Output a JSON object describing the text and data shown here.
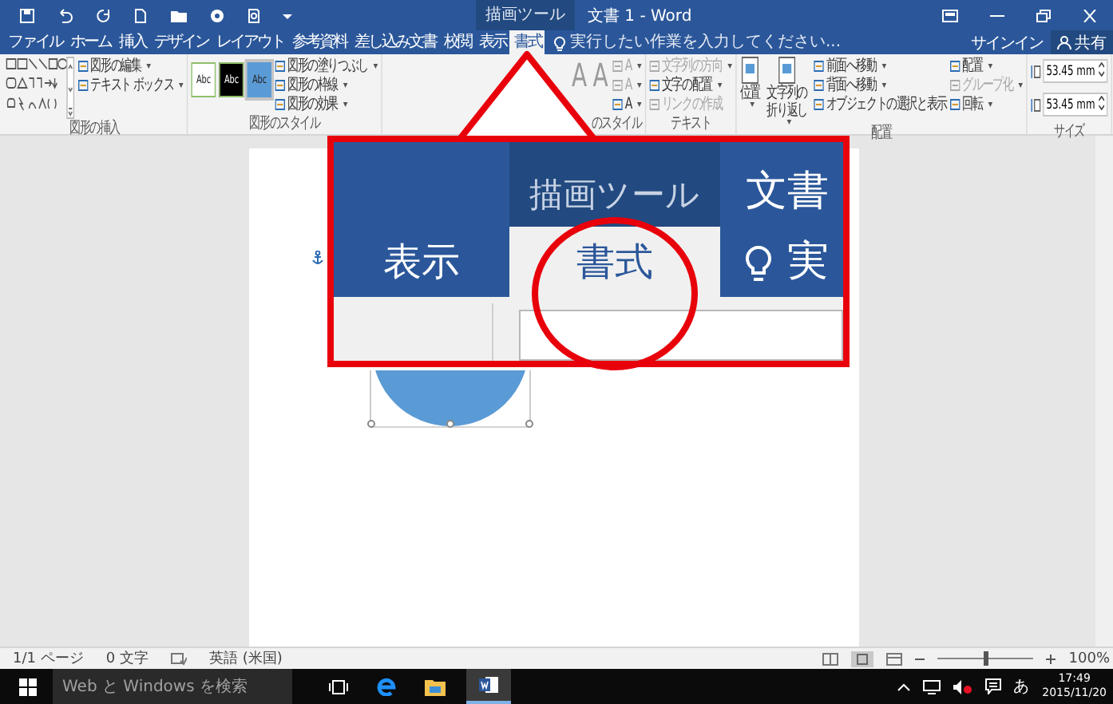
{
  "title_bar": {
    "contextual_tab": "描画ツール",
    "title": "文書 1 - Word"
  },
  "tabs": [
    {
      "label": "ファイル",
      "selected": false
    },
    {
      "label": "ホーム",
      "selected": false
    },
    {
      "label": "挿入",
      "selected": false
    },
    {
      "label": "デザイン",
      "selected": false
    },
    {
      "label": "レイアウト",
      "selected": false
    },
    {
      "label": "参考資料",
      "selected": false
    },
    {
      "label": "差し込み文書",
      "selected": false
    },
    {
      "label": "校閲",
      "selected": false
    },
    {
      "label": "表示",
      "selected": false
    },
    {
      "label": "書式",
      "selected": true
    }
  ],
  "tell_me": {
    "placeholder": "実行したい作業を入力してください..."
  },
  "account": {
    "sign_in": "サインイン",
    "share": "共有"
  },
  "ribbon_groups": [
    {
      "label": "図形の挿入",
      "columns": [
        [
          {
            "kind": "shapes"
          }
        ],
        [
          {
            "kind": "command",
            "label": "図形の編集",
            "menu": true,
            "disabled": false
          },
          {
            "kind": "command",
            "label": "テキスト ボックス",
            "menu": true,
            "disabled": false
          }
        ]
      ]
    },
    {
      "label": "図形のスタイル",
      "columns": [
        [
          {
            "kind": "swatch",
            "label": "Abc",
            "color": "#ffffff",
            "selected": false
          }
        ],
        [
          {
            "kind": "swatch",
            "label": "Abc",
            "color": "#000000",
            "selected": false
          }
        ],
        [
          {
            "kind": "swatch",
            "label": "Abc",
            "color": "#5b9bd5",
            "selected": true
          }
        ],
        [
          {
            "kind": "command",
            "label": "図形の塗りつぶし",
            "menu": true,
            "disabled": false
          },
          {
            "kind": "command",
            "label": "図形の枠線",
            "menu": true,
            "disabled": false
          },
          {
            "kind": "command",
            "label": "図形の効果",
            "menu": true,
            "disabled": false
          }
        ]
      ]
    },
    {
      "label": "のスタイル",
      "columns": [
        [
          {
            "kind": "letter",
            "label": "A"
          }
        ],
        [
          {
            "kind": "letter",
            "label": "A"
          }
        ],
        [
          {
            "kind": "command",
            "label": "A",
            "menu": true,
            "disabled": true
          },
          {
            "kind": "command",
            "label": "A",
            "menu": true,
            "disabled": true
          },
          {
            "kind": "command",
            "label": "A",
            "menu": true,
            "disabled": false
          }
        ]
      ]
    },
    {
      "label": "テキスト",
      "columns": [
        [
          {
            "kind": "command",
            "label": "文字列の方向",
            "menu": true,
            "disabled": true
          },
          {
            "kind": "command",
            "label": "文字の配置",
            "menu": true,
            "disabled": false
          },
          {
            "kind": "command",
            "label": "リンクの作成",
            "menu": false,
            "disabled": true
          }
        ]
      ]
    },
    {
      "label": "配置",
      "columns": [
        [
          {
            "kind": "large",
            "label": "位置",
            "menu": true
          }
        ],
        [
          {
            "kind": "large",
            "label": "文字列の折り返し",
            "menu": true
          }
        ],
        [
          {
            "kind": "command",
            "label": "前面へ移動",
            "menu": true,
            "disabled": false
          },
          {
            "kind": "command",
            "label": "背面へ移動",
            "menu": true,
            "disabled": false
          },
          {
            "kind": "command",
            "label": "オブジェクトの選択と表示",
            "menu": false,
            "disabled": false
          }
        ],
        [
          {
            "kind": "command",
            "label": "配置",
            "menu": true,
            "disabled": false
          },
          {
            "kind": "command",
            "label": "グループ化",
            "menu": true,
            "disabled": true
          },
          {
            "kind": "command",
            "label": "回転",
            "menu": true,
            "disabled": false
          }
        ]
      ]
    },
    {
      "label": "サイズ",
      "columns": [
        [
          {
            "kind": "spin",
            "value": "53.45 mm"
          },
          {
            "kind": "spin",
            "value": "53.45 mm"
          }
        ]
      ]
    }
  ],
  "callout": {
    "contextual_tab": "描画ツール",
    "title": "文書",
    "left_tab": "表示",
    "selected_tab": "書式",
    "tell_me": "実"
  },
  "status_bar": {
    "page": "1/1 ページ",
    "words": "0 文字",
    "language": "英語 (米国)",
    "zoom": "100%",
    "zoom_slider": {
      "level": 0.5
    }
  },
  "taskbar": {
    "search_placeholder": "Web と Windows を検索",
    "ime": "あ",
    "time": "17:49",
    "date": "2015/11/20"
  }
}
